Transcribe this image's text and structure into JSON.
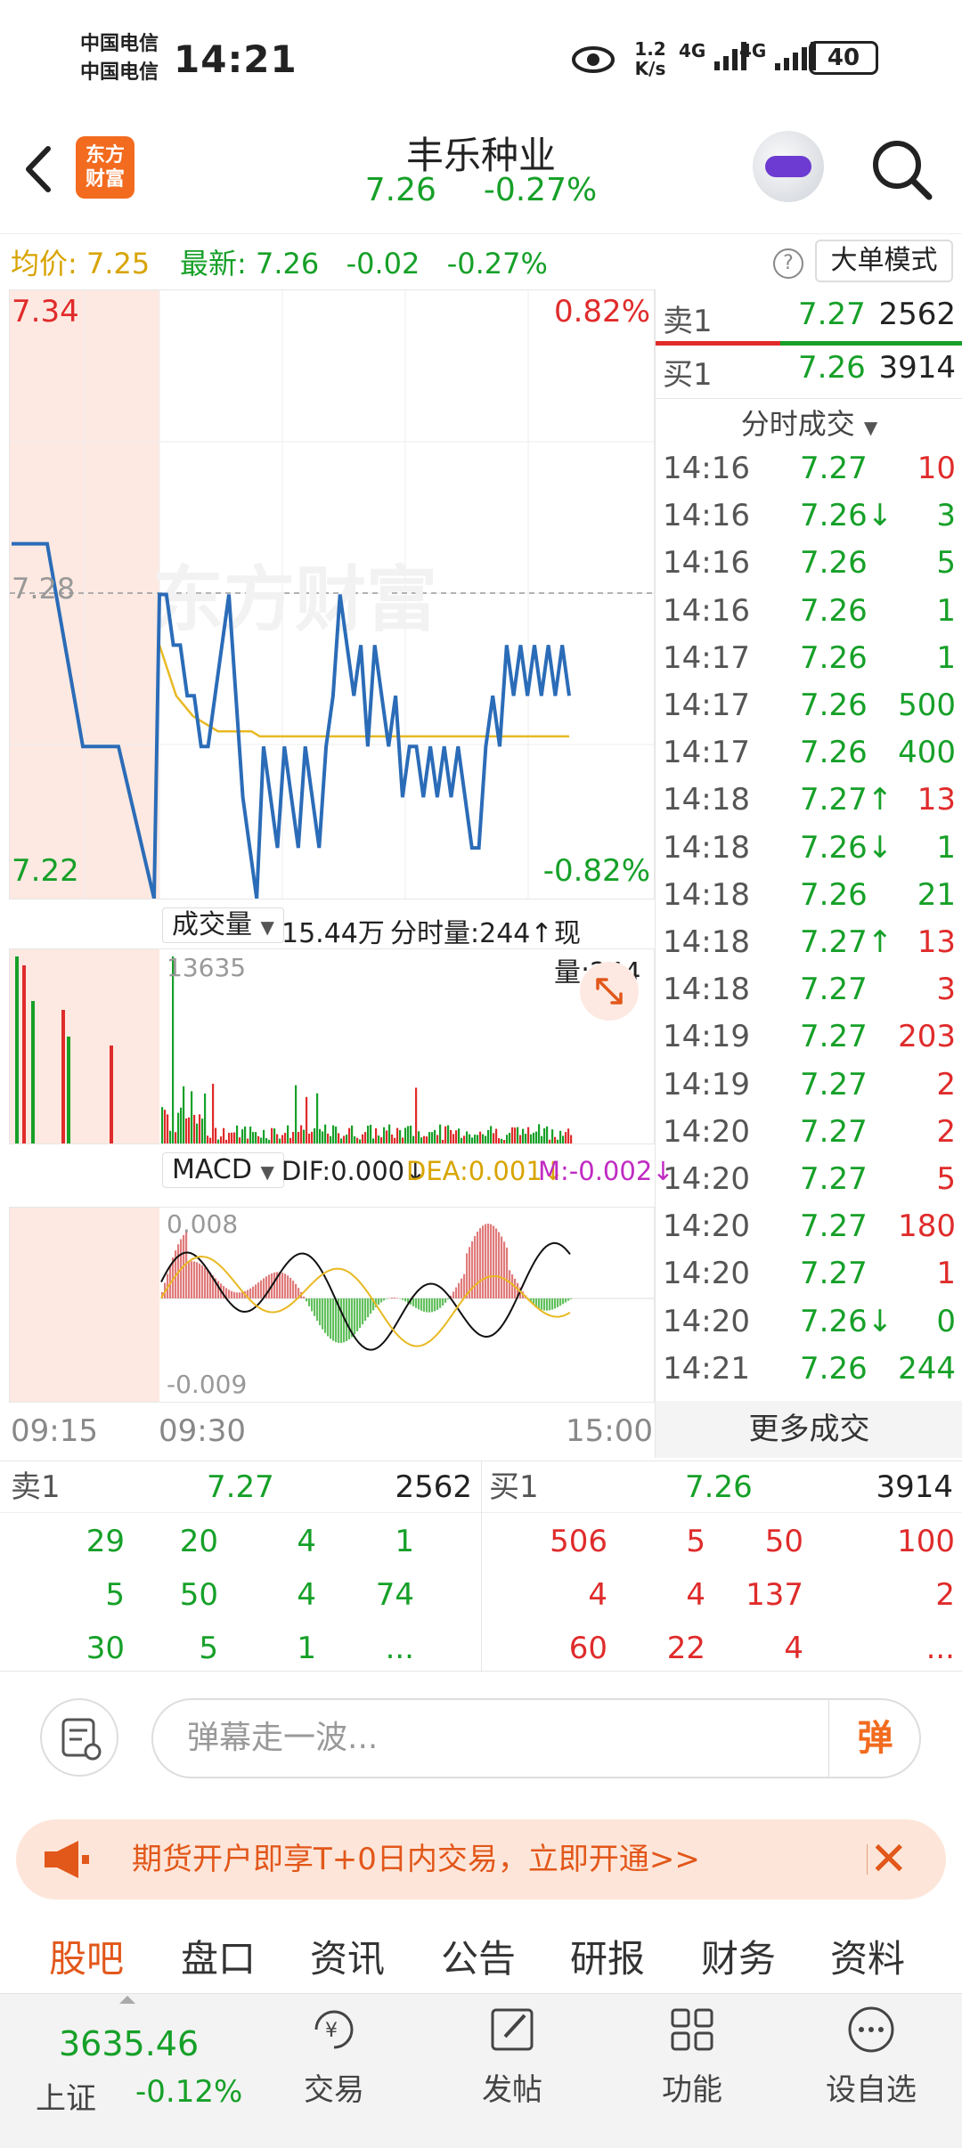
{
  "status": {
    "carrier1": "中国电信",
    "carrier2": "中国电信",
    "time": "14:21",
    "net_speed": "1.2\nK/s",
    "net_speed_top": "1.2",
    "net_speed_bottom": "K/s",
    "signal1": "4G",
    "signal2": "4G",
    "battery": "40"
  },
  "header": {
    "logo_line1": "东方",
    "logo_line2": "财富",
    "stock_name": "丰乐种业",
    "price": "7.26",
    "change_pct": "-0.27%"
  },
  "info": {
    "avg_label": "均价:",
    "avg_value": "7.25",
    "latest_label": "最新:",
    "latest_value": "7.26",
    "latest_change": "-0.02",
    "latest_pct": "-0.27%",
    "help": "?",
    "big_order_mode": "大单模式"
  },
  "chart": {
    "top_price": "7.34",
    "top_pct": "0.82%",
    "mid_price": "7.28",
    "bottom_price": "7.22",
    "bottom_pct": "-0.82%",
    "watermark": "东方财富",
    "vol_selector": "成交量",
    "vol_total": "15.44万",
    "vol_period_label": "分时量:244↑",
    "vol_now_label": "现量:244",
    "vol_max": "13635",
    "macd_selector": "MACD",
    "dif": "DIF:0.000↓",
    "dea": "DEA:0.001↓",
    "m": "M:-0.002↓",
    "macd_top": "0.008",
    "macd_bottom": "-0.009",
    "time_start": "09:15",
    "time_open": "09:30",
    "time_end": "15:00",
    "colors": {
      "price_line": "#2b6cb8",
      "avg_line": "#e8b923",
      "up": "#e02b2b",
      "down": "#16a028",
      "pre_market": "#fde9e1"
    }
  },
  "chart_data": {
    "type": "line",
    "y_range": [
      7.22,
      7.34
    ],
    "prev_close": 7.28,
    "price_series": [
      7.29,
      7.29,
      7.25,
      7.25,
      7.22,
      7.28,
      7.28,
      7.27,
      7.27,
      7.26,
      7.26,
      7.25,
      7.25,
      7.26,
      7.27,
      7.28,
      7.26,
      7.24,
      7.23,
      7.22,
      7.25,
      7.24,
      7.23,
      7.25,
      7.24,
      7.23,
      7.25,
      7.24,
      7.23,
      7.25,
      7.26,
      7.28,
      7.27,
      7.26,
      7.27,
      7.25,
      7.27,
      7.26,
      7.25,
      7.26,
      7.24,
      7.25,
      7.25,
      7.24,
      7.25,
      7.24,
      7.25,
      7.24,
      7.25,
      7.24,
      7.23,
      7.23,
      7.25,
      7.26,
      7.25,
      7.27,
      7.26,
      7.27,
      7.26,
      7.27,
      7.26,
      7.27,
      7.26,
      7.27,
      7.26
    ],
    "avg_series": [
      7.27,
      7.265,
      7.26,
      7.258,
      7.256,
      7.255,
      7.254,
      7.253,
      7.253,
      7.253,
      7.253,
      7.253,
      7.252,
      7.252,
      7.252,
      7.252,
      7.252,
      7.252,
      7.252,
      7.252,
      7.252,
      7.252,
      7.252,
      7.252,
      7.252,
      7.252,
      7.252,
      7.252,
      7.252,
      7.252,
      7.252,
      7.252,
      7.252,
      7.252,
      7.252,
      7.252,
      7.252,
      7.252,
      7.252,
      7.252,
      7.252,
      7.252,
      7.252,
      7.252,
      7.252,
      7.252,
      7.252,
      7.252,
      7.252,
      7.252
    ]
  },
  "quotes": {
    "sell1_label": "卖1",
    "sell1_price": "7.27",
    "sell1_vol": "2562",
    "buy1_label": "买1",
    "buy1_price": "7.26",
    "buy1_vol": "3914"
  },
  "trades": {
    "header": "分时成交",
    "rows": [
      {
        "time": "14:16",
        "price": "7.27",
        "vol": "10"
      },
      {
        "time": "14:16",
        "price": "7.26↓",
        "vol": "3"
      },
      {
        "time": "14:16",
        "price": "7.26",
        "vol": "5"
      },
      {
        "time": "14:16",
        "price": "7.26",
        "vol": "1"
      },
      {
        "time": "14:17",
        "price": "7.26",
        "vol": "1"
      },
      {
        "time": "14:17",
        "price": "7.26",
        "vol": "500"
      },
      {
        "time": "14:17",
        "price": "7.26",
        "vol": "400"
      },
      {
        "time": "14:18",
        "price": "7.27↑",
        "vol": "13"
      },
      {
        "time": "14:18",
        "price": "7.26↓",
        "vol": "1"
      },
      {
        "time": "14:18",
        "price": "7.26",
        "vol": "21"
      },
      {
        "time": "14:18",
        "price": "7.27↑",
        "vol": "13"
      },
      {
        "time": "14:18",
        "price": "7.27",
        "vol": "3"
      },
      {
        "time": "14:19",
        "price": "7.27",
        "vol": "203"
      },
      {
        "time": "14:19",
        "price": "7.27",
        "vol": "2"
      },
      {
        "time": "14:20",
        "price": "7.27",
        "vol": "2"
      },
      {
        "time": "14:20",
        "price": "7.27",
        "vol": "5"
      },
      {
        "time": "14:20",
        "price": "7.27",
        "vol": "180"
      },
      {
        "time": "14:20",
        "price": "7.27",
        "vol": "1"
      },
      {
        "time": "14:20",
        "price": "7.26↓",
        "vol": "0"
      },
      {
        "time": "14:21",
        "price": "7.26",
        "vol": "244"
      }
    ],
    "more": "更多成交"
  },
  "orderbook": {
    "sell_label": "卖1",
    "sell_price": "7.27",
    "sell_vol": "2562",
    "buy_label": "买1",
    "buy_price": "7.26",
    "buy_vol": "3914",
    "sell_rows": [
      [
        "29",
        "20",
        "4",
        "1"
      ],
      [
        "5",
        "50",
        "4",
        "74"
      ],
      [
        "30",
        "5",
        "1",
        "..."
      ]
    ],
    "buy_rows": [
      [
        "506",
        "5",
        "50",
        "100"
      ],
      [
        "4",
        "4",
        "137",
        "2"
      ],
      [
        "60",
        "22",
        "4",
        "..."
      ]
    ]
  },
  "danmu": {
    "placeholder": "弹幕走一波...",
    "send": "弹"
  },
  "promo": {
    "text": "期货开户即享T+0日内交易，立即开通>>",
    "close": "✕"
  },
  "tabs": [
    "股吧",
    "盘口",
    "资讯",
    "公告",
    "研报",
    "财务",
    "资料"
  ],
  "bottomnav": {
    "index_value": "3635.46",
    "index_name": "上证",
    "index_change": "-0.12%",
    "items": [
      "交易",
      "发帖",
      "功能",
      "设自选"
    ]
  }
}
